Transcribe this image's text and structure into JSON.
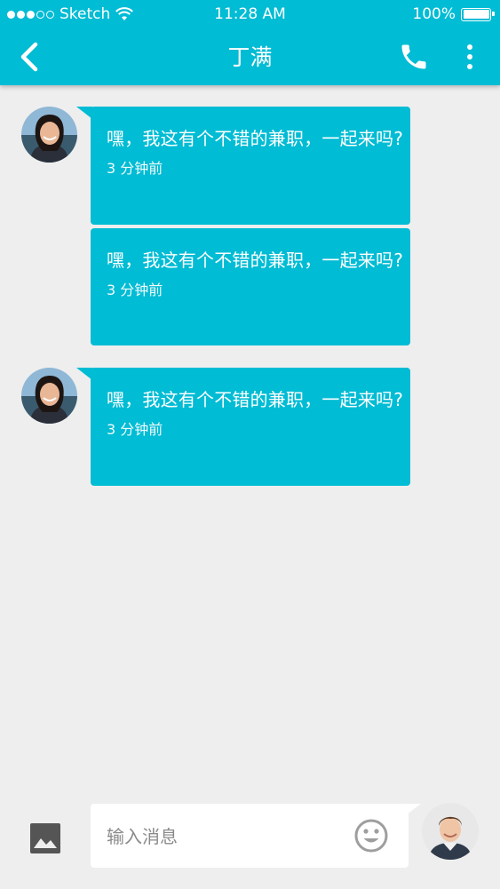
{
  "status_bar": {
    "carrier": "Sketch",
    "time": "11:28 AM",
    "battery": "100%"
  },
  "nav": {
    "title": "丁满",
    "icons": [
      "back-chevron-icon",
      "phone-icon",
      "more-vertical-icon"
    ]
  },
  "messages": [
    {
      "text": "嘿，我这有个不错的兼职，一起来吗?",
      "time": "3 分钟前"
    },
    {
      "text": "嘿，我这有个不错的兼职，一起来吗?",
      "time": "3 分钟前"
    },
    {
      "text": "嘿，我这有个不错的兼职，一起来吗?",
      "time": "3 分钟前"
    }
  ],
  "composer": {
    "placeholder": "输入消息",
    "value": ""
  },
  "colors": {
    "accent": "#00bcd4",
    "background": "#eeeeee"
  }
}
